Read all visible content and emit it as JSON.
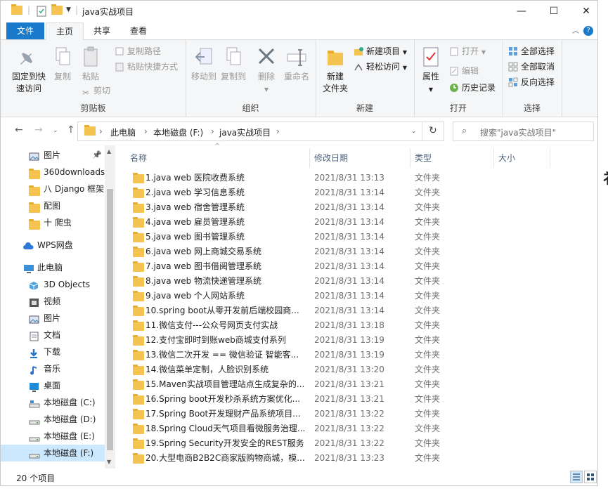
{
  "window": {
    "title": "java实战项目",
    "minimize": "—",
    "maximize": "☐",
    "close": "✕"
  },
  "ribbon_tabs": {
    "file": "文件",
    "home": "主页",
    "share": "共享",
    "view": "查看"
  },
  "ribbon": {
    "clipboard": {
      "label": "剪贴板",
      "pin": "固定到快速访问",
      "pin_l1": "固定到快",
      "pin_l2": "速访问",
      "copy": "复制",
      "paste": "粘贴",
      "copy_path": "复制路径",
      "paste_shortcut": "粘贴快捷方式",
      "cut": "剪切"
    },
    "organize": {
      "label": "组织",
      "move_to": "移动到",
      "copy_to": "复制到",
      "delete": "删除",
      "rename": "重命名"
    },
    "new": {
      "label": "新建",
      "new_folder_l1": "新建",
      "new_folder_l2": "文件夹",
      "new_item": "新建项目",
      "easy_access": "轻松访问"
    },
    "open": {
      "label": "打开",
      "properties": "属性",
      "open": "打开",
      "edit": "编辑",
      "history": "历史记录"
    },
    "select": {
      "label": "选择",
      "select_all": "全部选择",
      "select_none": "全部取消",
      "invert": "反向选择"
    }
  },
  "address": {
    "crumbs": [
      "此电脑",
      "本地磁盘 (F:)",
      "java实战项目"
    ],
    "search_placeholder": "搜索\"java实战项目\""
  },
  "nav_pane": [
    {
      "label": "图片",
      "icon": "pictures-icon",
      "pinned": true
    },
    {
      "label": "360downloads",
      "icon": "folder-icon"
    },
    {
      "label": "八 Django 框架",
      "icon": "folder-icon"
    },
    {
      "label": "配图",
      "icon": "folder-icon"
    },
    {
      "label": "十 爬虫",
      "icon": "folder-icon"
    },
    {
      "label": "WPS网盘",
      "icon": "cloud-icon"
    },
    {
      "label": "此电脑",
      "icon": "this-pc-icon"
    },
    {
      "label": "3D Objects",
      "icon": "3d-objects-icon"
    },
    {
      "label": "视频",
      "icon": "video-icon"
    },
    {
      "label": "图片",
      "icon": "pictures-icon"
    },
    {
      "label": "文档",
      "icon": "documents-icon"
    },
    {
      "label": "下载",
      "icon": "download-icon"
    },
    {
      "label": "音乐",
      "icon": "music-icon"
    },
    {
      "label": "桌面",
      "icon": "desktop-icon"
    },
    {
      "label": "本地磁盘 (C:)",
      "icon": "drive-c-icon"
    },
    {
      "label": "本地磁盘 (D:)",
      "icon": "drive-icon"
    },
    {
      "label": "本地磁盘 (E:)",
      "icon": "drive-icon"
    },
    {
      "label": "本地磁盘 (F:)",
      "icon": "drive-icon",
      "selected": true
    }
  ],
  "columns": {
    "name": "名称",
    "date": "修改日期",
    "type": "类型",
    "size": "大小"
  },
  "files": [
    {
      "name": "1.java  web  医院收费系统",
      "date": "2021/8/31 13:13",
      "type": "文件夹"
    },
    {
      "name": "2.java web 学习信息系统",
      "date": "2021/8/31 13:14",
      "type": "文件夹"
    },
    {
      "name": "3.java web  宿舍管理系统",
      "date": "2021/8/31 13:14",
      "type": "文件夹"
    },
    {
      "name": "4.java web  雇员管理系统",
      "date": "2021/8/31 13:14",
      "type": "文件夹"
    },
    {
      "name": "5.java web  图书管理系统",
      "date": "2021/8/31 13:14",
      "type": "文件夹"
    },
    {
      "name": "6.java  web  网上商城交易系统",
      "date": "2021/8/31 13:14",
      "type": "文件夹"
    },
    {
      "name": "7.java  web 图书借阅管理系统",
      "date": "2021/8/31 13:14",
      "type": "文件夹"
    },
    {
      "name": "8.java web 物流快递管理系统",
      "date": "2021/8/31 13:14",
      "type": "文件夹"
    },
    {
      "name": "9.java  web 个人网站系统",
      "date": "2021/8/31 13:14",
      "type": "文件夹"
    },
    {
      "name": "10.spring boot从零开发前后端校园商...",
      "date": "2021/8/31 13:14",
      "type": "文件夹"
    },
    {
      "name": "11.微信支付---公众号网页支付实战",
      "date": "2021/8/31 13:18",
      "type": "文件夹"
    },
    {
      "name": "12.支付宝即时到账web商城支付系列",
      "date": "2021/8/31 13:19",
      "type": "文件夹"
    },
    {
      "name": "13.微信二次开发  ==  微信验证  智能客...",
      "date": "2021/8/31 13:19",
      "type": "文件夹"
    },
    {
      "name": "14.微信菜单定制，人脸识别系统",
      "date": "2021/8/31 13:20",
      "type": "文件夹"
    },
    {
      "name": "15.Maven实战项目管理站点生成复杂的...",
      "date": "2021/8/31 13:21",
      "type": "文件夹"
    },
    {
      "name": "16.Spring boot开发秒杀系统方案优化...",
      "date": "2021/8/31 13:21",
      "type": "文件夹"
    },
    {
      "name": "17.Spring Boot开发理财产品系统项目...",
      "date": "2021/8/31 13:22",
      "type": "文件夹"
    },
    {
      "name": "18.Spring Cloud天气项目看微服务治理...",
      "date": "2021/8/31 13:22",
      "type": "文件夹"
    },
    {
      "name": "19.Spring Security开发安全的REST服务",
      "date": "2021/8/31 13:22",
      "type": "文件夹"
    },
    {
      "name": "20.大型电商B2B2C商家版购物商城，模...",
      "date": "2021/8/31 13:23",
      "type": "文件夹"
    }
  ],
  "status": {
    "count": "20 个项目"
  }
}
